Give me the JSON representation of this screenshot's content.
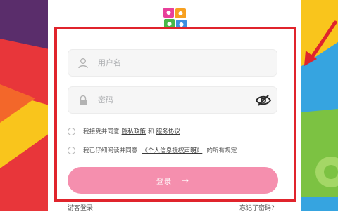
{
  "form": {
    "username_placeholder": "用户名",
    "password_placeholder": "密码"
  },
  "agreements": [
    {
      "prefix": "我接受并同意",
      "link1": "隐私政策",
      "joiner": "和",
      "link2": "服务协议",
      "suffix": ""
    },
    {
      "prefix": "我已仔细阅读并同意",
      "link1": "《个人信息授权声明》",
      "joiner": "",
      "link2": "",
      "suffix": "的所有规定"
    }
  ],
  "login_button": {
    "label": "登录",
    "arrow": "→"
  },
  "footer": {
    "guest_login": "游客登录",
    "forgot_password": "忘记了密码?"
  },
  "colors": {
    "accent_pink": "#f58fae",
    "highlight_red": "#e0242c",
    "bg_purple": "#5a2d6b",
    "bg_red": "#e8363a",
    "bg_yellow": "#f9c51c",
    "bg_blue": "#36a4e0",
    "bg_green": "#7cc242"
  },
  "icons": [
    "user-icon",
    "lock-icon",
    "eye-off-icon",
    "arrow-right-icon",
    "app-logo",
    "red-arrow-icon"
  ]
}
